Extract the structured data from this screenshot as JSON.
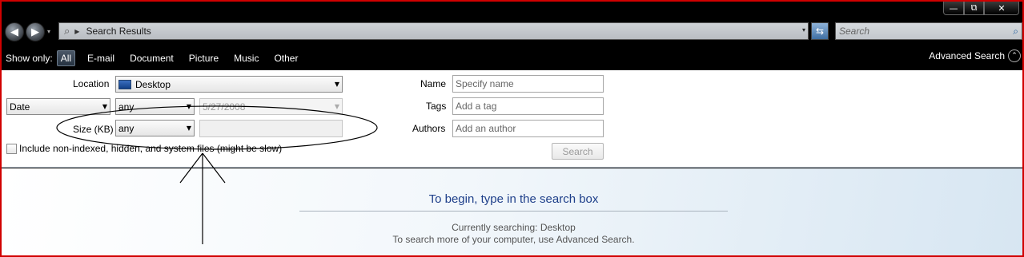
{
  "window_buttons": {
    "minimize": "—",
    "maximize": "⧉",
    "close": "✕"
  },
  "address": {
    "back_icon": "back-arrow-icon",
    "forward_icon": "forward-arrow-icon",
    "back_glyph": "◀",
    "forward_glyph": "▶",
    "nav_dropdown_glyph": "▾",
    "search_glyph": "⌕",
    "crumb_arrow": "▶",
    "path": "Search Results",
    "dropdown_glyph": "▾",
    "refresh_glyph": "⇆"
  },
  "search": {
    "placeholder": "Search",
    "icon_glyph": "⌕"
  },
  "filterbar": {
    "label": "Show only:",
    "items": [
      "All",
      "E-mail",
      "Document",
      "Picture",
      "Music",
      "Other"
    ],
    "active_index": 0,
    "advanced_search": "Advanced Search",
    "chevron_glyph": "⌃"
  },
  "panel": {
    "location_label": "Location",
    "location_value": "Desktop",
    "date_type": "Date",
    "date_condition": "any",
    "date_value": "5/27/2008",
    "size_label": "Size (KB)",
    "size_condition": "any",
    "size_value": "",
    "include_label": "Include non-indexed, hidden, and system files (might be slow)",
    "name_label": "Name",
    "name_placeholder": "Specify name",
    "tags_label": "Tags",
    "tags_placeholder": "Add a tag",
    "authors_label": "Authors",
    "authors_placeholder": "Add an author",
    "search_button": "Search",
    "combo_arrow": "▼"
  },
  "results": {
    "heading": "To begin, type in the search box",
    "currently": "Currently searching: Desktop",
    "more": "To search more of your computer, use Advanced Search."
  },
  "colors": {
    "frame_border": "#d10000",
    "heading_blue": "#1e3f8a",
    "filter_bar": "#000000"
  }
}
